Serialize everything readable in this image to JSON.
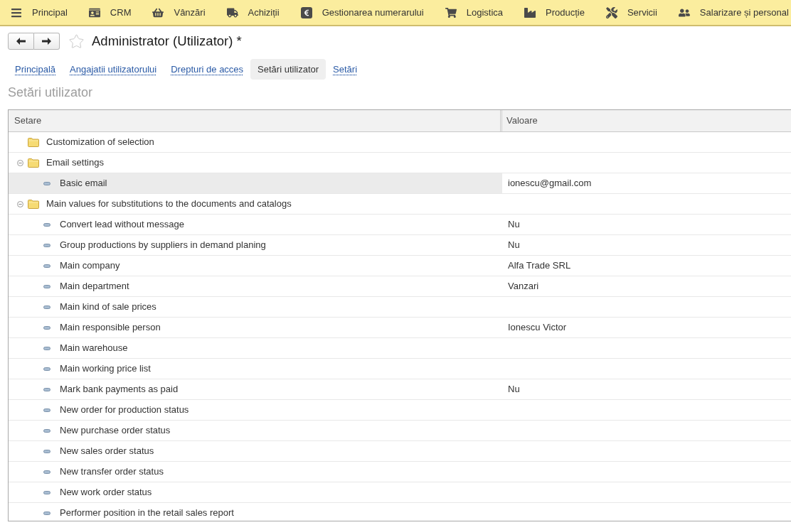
{
  "top_menu": [
    "Principal",
    "CRM",
    "Vânzări",
    "Achiziții",
    "Gestionarea numerarului",
    "Logistica",
    "Producție",
    "Servicii",
    "Salarizare și personal"
  ],
  "header": {
    "title": "Administrator (Utilizator) *",
    "favorite": false
  },
  "tabs": [
    {
      "label": "Principală",
      "selected": false
    },
    {
      "label": "Angajatii utilizatorului",
      "selected": false
    },
    {
      "label": "Drepturi de acces",
      "selected": false
    },
    {
      "label": "Setări utilizator",
      "selected": true
    },
    {
      "label": "Setări",
      "selected": false
    }
  ],
  "section_title": "Setări utilizator",
  "table": {
    "columns": [
      "Setare",
      "Valoare"
    ],
    "rows": [
      {
        "kind": "group",
        "label": "Customization of selection",
        "selected": false
      },
      {
        "kind": "group",
        "label": "Email settings",
        "expanded": true,
        "selected": false,
        "children": [
          {
            "kind": "setting",
            "label": "Basic email",
            "value": "ionescu@gmail.com",
            "selected": true
          }
        ]
      },
      {
        "kind": "group",
        "label": "Main values for substitutions to the documents and catalogs",
        "expanded": true,
        "selected": false,
        "children": [
          {
            "kind": "setting",
            "label": "Convert lead without message",
            "value": "Nu",
            "selected": false
          },
          {
            "kind": "setting",
            "label": "Group productions by suppliers in demand planing",
            "value": "Nu",
            "selected": false
          },
          {
            "kind": "setting",
            "label": "Main company",
            "value": "Alfa Trade SRL",
            "selected": false
          },
          {
            "kind": "setting",
            "label": "Main department",
            "value": "Vanzari",
            "selected": false
          },
          {
            "kind": "setting",
            "label": "Main kind of sale prices",
            "selected": false
          },
          {
            "kind": "setting",
            "label": "Main responsible person",
            "value": "Ionescu Victor",
            "selected": false
          },
          {
            "kind": "setting",
            "label": "Main warehouse",
            "selected": false
          },
          {
            "kind": "setting",
            "label": "Main working price list",
            "selected": false
          },
          {
            "kind": "setting",
            "label": "Mark bank payments as paid",
            "value": "Nu",
            "selected": false
          },
          {
            "kind": "setting",
            "label": "New order for production status",
            "selected": false
          },
          {
            "kind": "setting",
            "label": "New purchase order status",
            "selected": false
          },
          {
            "kind": "setting",
            "label": "New sales order status",
            "selected": false
          },
          {
            "kind": "setting",
            "label": "New transfer order status",
            "selected": false
          },
          {
            "kind": "setting",
            "label": "New work order status",
            "selected": false
          },
          {
            "kind": "setting",
            "label": "Performer position in the retail sales report",
            "selected": false
          }
        ]
      }
    ]
  }
}
